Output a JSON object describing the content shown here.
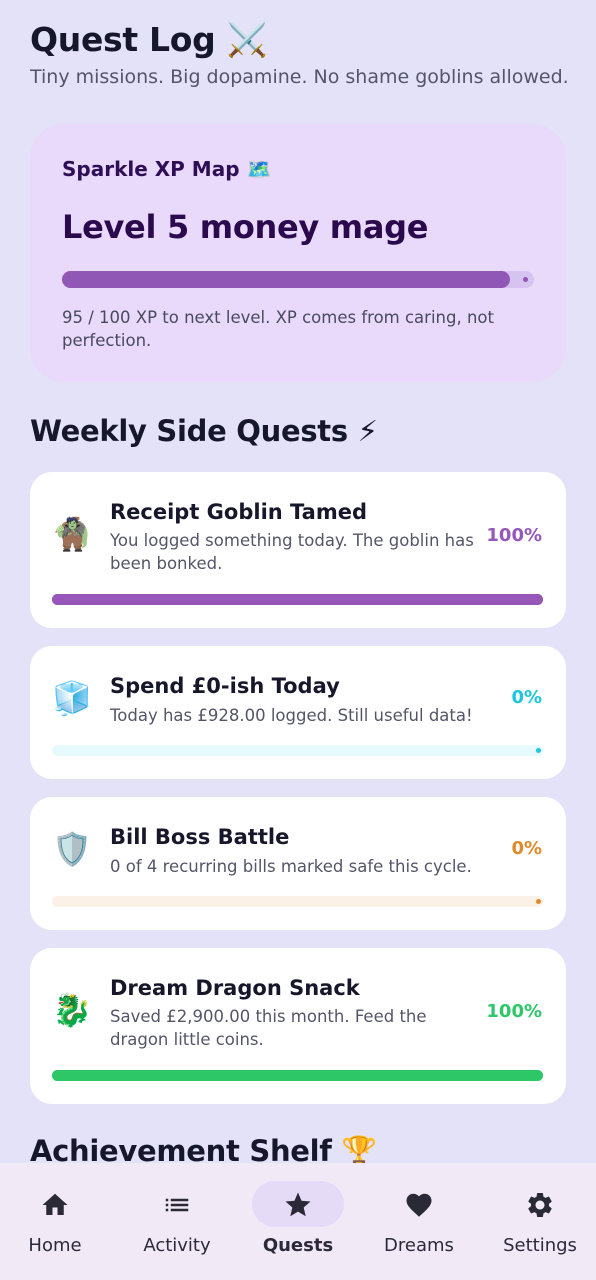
{
  "header": {
    "title": "Quest Log ⚔️",
    "subtitle": "Tiny missions. Big dopamine. No shame goblins allowed."
  },
  "xp_card": {
    "title": "Sparkle XP Map 🗺️",
    "level": "Level 5 money mage",
    "progress": 0.95,
    "note": "95 / 100 XP to next level. XP comes from caring, not perfection."
  },
  "weekly": {
    "title": "Weekly Side Quests ⚡",
    "quests": [
      {
        "icon": "🧌",
        "name": "Receipt Goblin Tamed",
        "desc": "You logged something today. The goblin has been bonked.",
        "pct": "100%",
        "progress": 1.0,
        "color": "#9657b8",
        "track": "#ead8f5"
      },
      {
        "icon": "🧊",
        "name": "Spend £0-ish Today",
        "desc": "Today has £928.00 logged. Still useful data!",
        "pct": "0%",
        "progress": 0.0,
        "color": "#1cc6dc",
        "track": "#e6fafd"
      },
      {
        "icon": "🛡️",
        "name": "Bill Boss Battle",
        "desc": "0 of 4 recurring bills marked safe this cycle.",
        "pct": "0%",
        "progress": 0.0,
        "color": "#e08a2a",
        "track": "#fcf1e6"
      },
      {
        "icon": "🐉",
        "name": "Dream Dragon Snack",
        "desc": "Saved £2,900.00 this month. Feed the dragon little coins.",
        "pct": "100%",
        "progress": 1.0,
        "color": "#2ec768",
        "track": "#dff6e7"
      }
    ]
  },
  "achievements": {
    "title": "Achievement Shelf 🏆"
  },
  "tabs": [
    {
      "label": "Home",
      "icon": "home-icon"
    },
    {
      "label": "Activity",
      "icon": "list-icon"
    },
    {
      "label": "Quests",
      "icon": "star-icon",
      "active": true
    },
    {
      "label": "Dreams",
      "icon": "heart-icon"
    },
    {
      "label": "Settings",
      "icon": "gear-icon"
    }
  ],
  "colors": {
    "background": "#e3e2f8",
    "xp_card": "#e9d9fb",
    "xp_fill": "#9057b5",
    "tabbar": "#f2e9f7",
    "active_pill": "#e6dbf6"
  }
}
